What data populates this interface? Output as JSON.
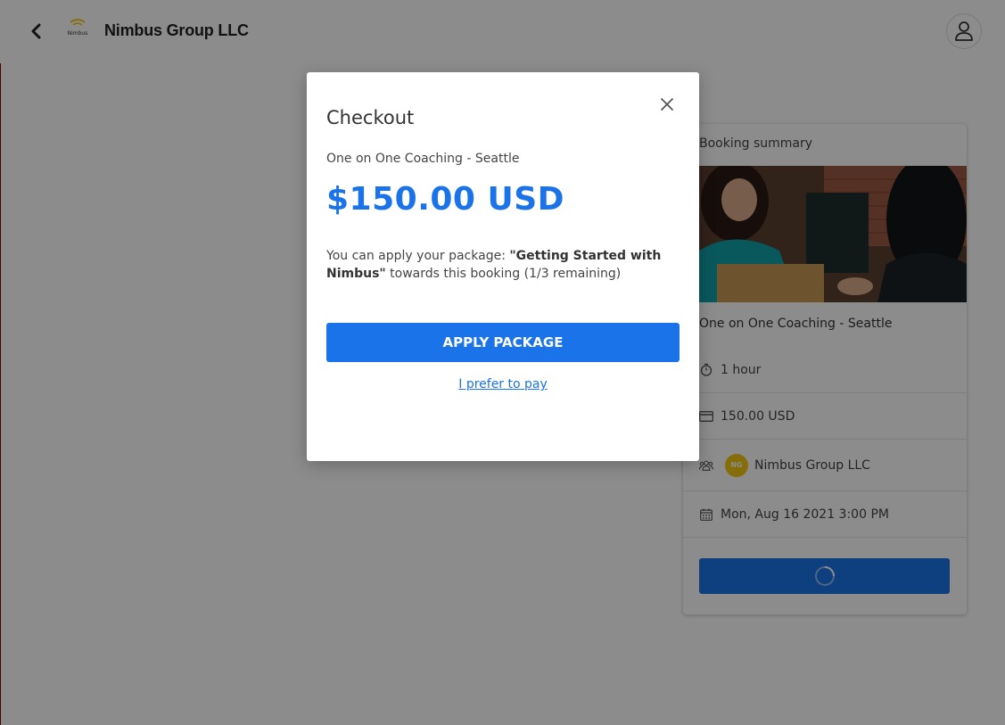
{
  "header": {
    "brand_name": "Nimbus Group LLC",
    "logo_text": "Nimbus",
    "back_icon": "chevron-left-icon",
    "user_icon": "user-icon"
  },
  "summary": {
    "title": "Booking summary",
    "service": "One on One Coaching - Seattle",
    "duration": "1 hour",
    "price": "150.00 USD",
    "org_initials": "NG",
    "organizer": "Nimbus Group LLC",
    "datetime": "Mon, Aug 16 2021 3:00 PM"
  },
  "modal": {
    "title": "Checkout",
    "service": "One on One Coaching - Seattle",
    "price": "$150.00 USD",
    "msg_prefix": "You can apply your package: ",
    "package_name": "\"Getting Started with Nimbus\"",
    "msg_suffix": " towards this booking (1/3 remaining)",
    "apply_label": "APPLY PACKAGE",
    "pay_label": "I prefer to pay"
  },
  "colors": {
    "accent": "#1a73e8",
    "badge": "#f2c811"
  }
}
